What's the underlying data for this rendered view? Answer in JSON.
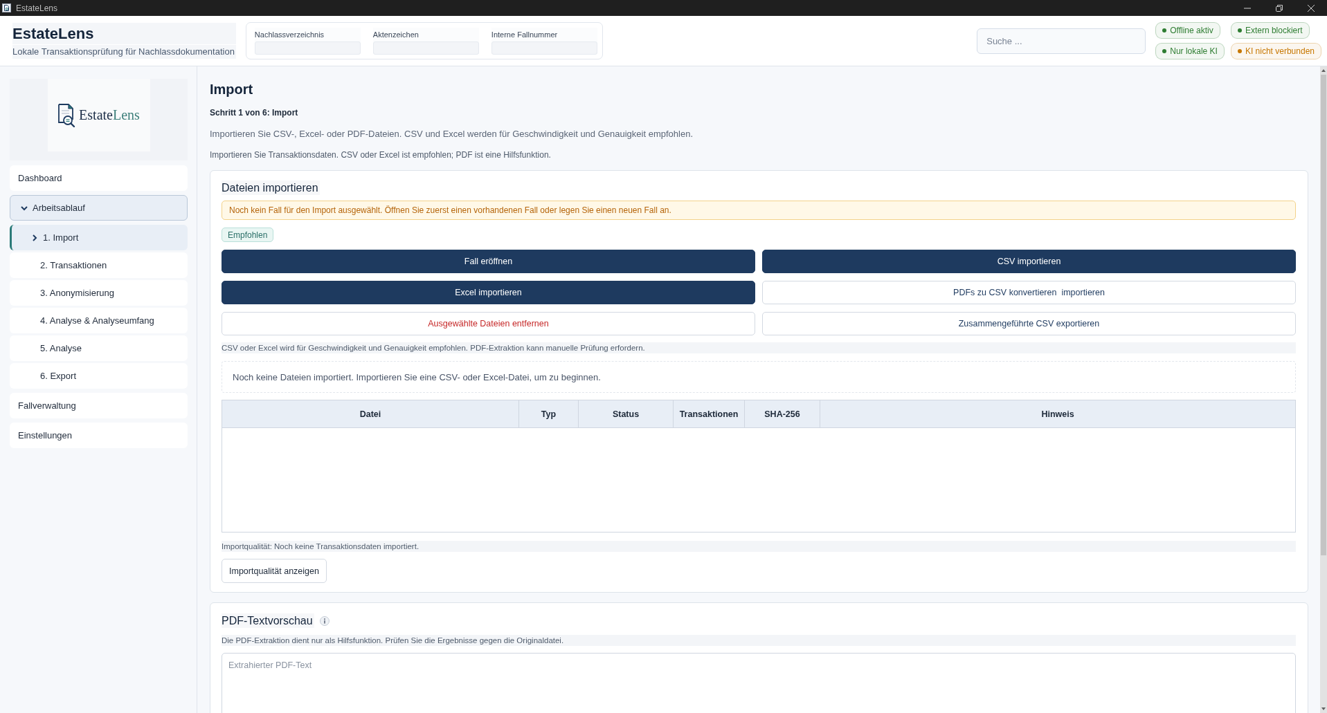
{
  "window": {
    "title": "EstateLens"
  },
  "app_header": {
    "title": "EstateLens",
    "subtitle": "Lokale Transaktionsprüfung für Nachlassdokumentation",
    "case_fields": [
      {
        "label": "Nachlassverzeichnis"
      },
      {
        "label": "Aktenzeichen"
      },
      {
        "label": "Interne Fallnummer"
      }
    ],
    "search": {
      "placeholder": "Suche ..."
    },
    "status_badges": [
      {
        "label": "Offline aktiv",
        "color": "#2e7d32"
      },
      {
        "label": "Extern blockiert",
        "color": "#2e7d32"
      },
      {
        "label": "Nur lokale KI",
        "color": "#2e7d32"
      },
      {
        "label": "KI nicht verbunden",
        "color": "#c77700"
      }
    ]
  },
  "sidebar": {
    "logo": {
      "name_main": "Estate",
      "name_accent": "Lens"
    },
    "nav": [
      {
        "label": "Dashboard",
        "kind": "link",
        "selected": false
      },
      {
        "label": "Arbeitsablauf",
        "kind": "group",
        "selected": false,
        "expanded": true,
        "children": [
          {
            "label": "1. Import",
            "selected": true
          },
          {
            "label": "2. Transaktionen",
            "selected": false
          },
          {
            "label": "3. Anonymisierung",
            "selected": false
          },
          {
            "label": "4. Analyse & Analyseumfang",
            "selected": false
          },
          {
            "label": "5. Analyse",
            "selected": false
          },
          {
            "label": "6. Export",
            "selected": false
          }
        ]
      },
      {
        "label": "Fallverwaltung",
        "kind": "link",
        "selected": false
      },
      {
        "label": "Einstellungen",
        "kind": "link",
        "selected": false
      }
    ]
  },
  "page": {
    "title": "Import",
    "step": "Schritt 1 von 6: Import",
    "intro": "Importieren Sie CSV-, Excel- oder PDF-Dateien. CSV und Excel werden für Geschwindigkeit und Genauigkeit empfohlen.",
    "hint": "Importieren Sie Transaktionsdaten. CSV oder Excel ist empfohlen; PDF ist eine Hilfsfunktion."
  },
  "import_card": {
    "title": "Dateien importieren",
    "warning": "Noch kein Fall für den Import ausgewählt. Öffnen Sie zuerst einen vorhandenen Fall oder legen Sie einen neuen Fall an.",
    "tag": "Empfohlen",
    "buttons": [
      {
        "label": "Fall eröffnen",
        "kind": "primary"
      },
      {
        "label": "CSV importieren",
        "kind": "primary"
      },
      {
        "label": "Excel importieren",
        "kind": "primary"
      },
      {
        "label": "PDFs zu CSV konvertieren  importieren",
        "kind": "secondary"
      },
      {
        "label": "Ausgewählte Dateien entfernen",
        "kind": "danger"
      },
      {
        "label": "Zusammengeführte CSV exportieren",
        "kind": "secondary"
      }
    ],
    "note": "CSV oder Excel wird für Geschwindigkeit und Genauigkeit empfohlen. PDF-Extraktion kann manuelle Prüfung erfordern.",
    "empty_message": "Noch keine Dateien importiert. Importieren Sie eine CSV- oder Excel-Datei, um zu beginnen.",
    "table": {
      "columns": [
        "Datei",
        "Typ",
        "Status",
        "Transaktionen",
        "SHA-256",
        "Hinweis"
      ]
    },
    "quality": "Importqualität: Noch keine Transaktionsdaten importiert.",
    "quality_button": "Importqualität anzeigen"
  },
  "pdf_card": {
    "title": "PDF-Textvorschau",
    "description": "Die PDF-Extraktion dient nur als Hilfsfunktion. Prüfen Sie die Ergebnisse gegen die Originaldatei.",
    "text_area": {
      "placeholder": "Extrahierter PDF-Text"
    }
  }
}
